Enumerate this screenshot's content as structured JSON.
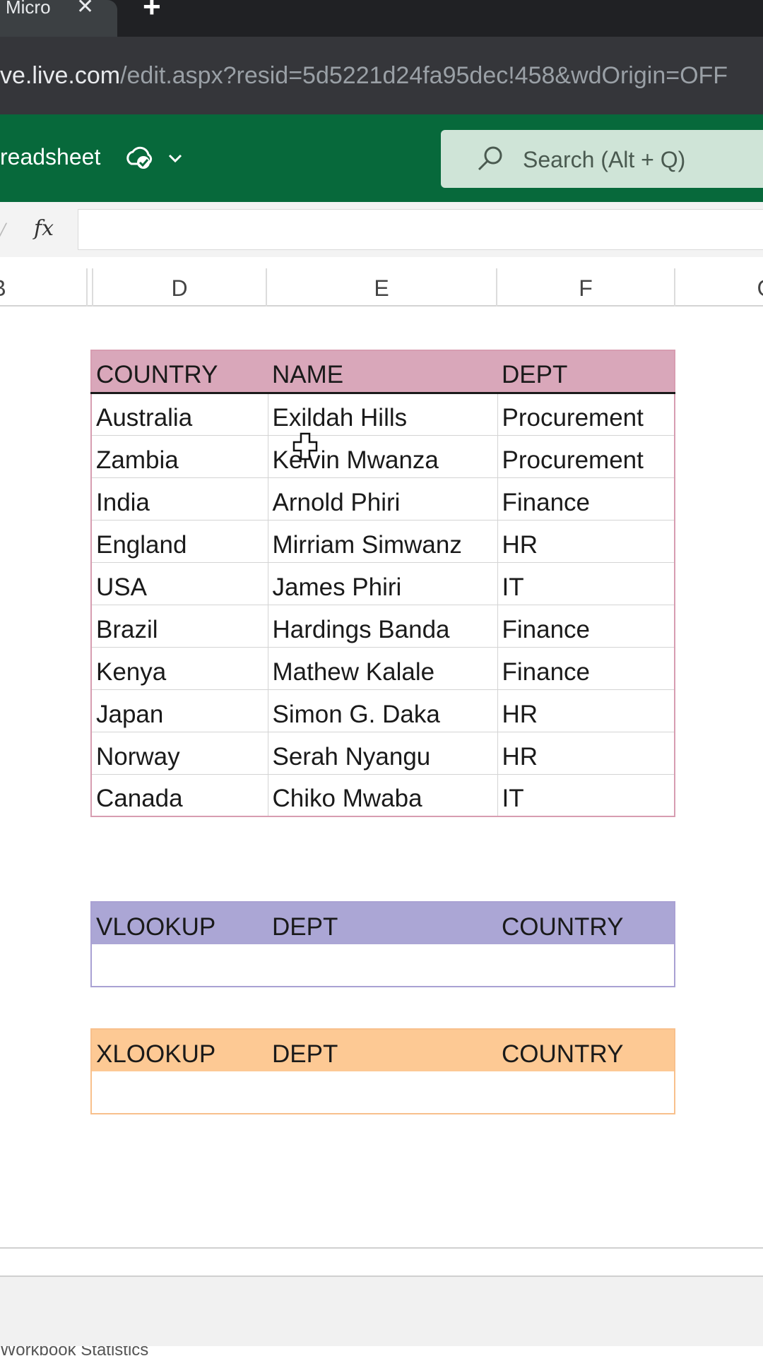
{
  "browser": {
    "tab_title": "Micro",
    "tab_close": "✕",
    "new_tab": "+",
    "url_host": "ve.live.com",
    "url_path": "/edit.aspx?resid=5d5221d24fa95dec!458&wdOrigin=OFF"
  },
  "app": {
    "doc_name": "readsheet",
    "search_placeholder": "Search (Alt + Q)",
    "brand_color": "#07693b"
  },
  "formula_bar": {
    "fx_label": "fx",
    "value": ""
  },
  "column_headers": [
    "B",
    "D",
    "E",
    "F",
    "G"
  ],
  "main_table": {
    "headers": [
      "COUNTRY",
      "NAME",
      "DEPT"
    ],
    "rows": [
      [
        "Australia",
        "Exildah Hills",
        "Procurement"
      ],
      [
        "Zambia",
        "Kelvin Mwanza",
        "Procurement"
      ],
      [
        "India",
        "Arnold Phiri",
        "Finance"
      ],
      [
        "England",
        "Mirriam Simwanz",
        "HR"
      ],
      [
        "USA",
        "James Phiri",
        "IT"
      ],
      [
        "Brazil",
        "Hardings Banda",
        "Finance"
      ],
      [
        "Kenya",
        "Mathew Kalale",
        "Finance"
      ],
      [
        "Japan",
        "Simon G. Daka",
        "HR"
      ],
      [
        "Norway",
        "Serah Nyangu",
        "HR"
      ],
      [
        "Canada",
        "Chiko Mwaba",
        "IT"
      ]
    ],
    "header_color": "#d9a7ba"
  },
  "vlookup_table": {
    "headers": [
      "VLOOKUP",
      "DEPT",
      "COUNTRY"
    ],
    "row": [
      "",
      "",
      ""
    ],
    "header_color": "#aba6d5"
  },
  "xlookup_table": {
    "headers": [
      "XLOOKUP",
      "DEPT",
      "COUNTRY"
    ],
    "row": [
      "",
      "",
      ""
    ],
    "header_color": "#fdc994"
  },
  "status": {
    "text": "Workbook Statistics"
  }
}
